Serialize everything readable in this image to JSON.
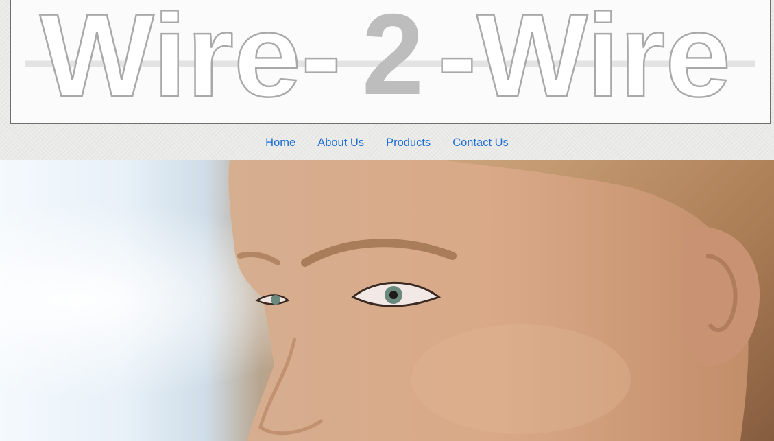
{
  "header": {
    "logo": {
      "left_word": "Wire-",
      "middle_digit": "2",
      "right_word": "-Wire"
    }
  },
  "nav": {
    "items": [
      {
        "label": "Home"
      },
      {
        "label": "About Us"
      },
      {
        "label": "Products"
      },
      {
        "label": "Contact Us"
      }
    ],
    "link_color": "#1f6fd0"
  },
  "hero": {
    "image": "woman-face-profile-photo"
  },
  "colors": {
    "page_background": "#e9e9e8",
    "logo_outline": "#a9a9a9",
    "logo_digit": "#bdbdbd",
    "banner_background": "#fbfbfb"
  }
}
